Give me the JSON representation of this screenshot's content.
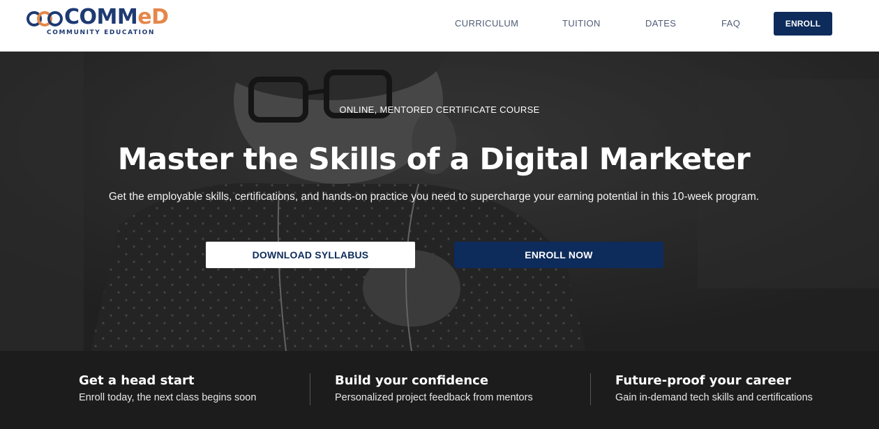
{
  "brand": {
    "name_part1": "COMM",
    "name_part2": "eD",
    "tagline": "COMMUNITY EDUCATION",
    "primary_color": "#1e3a73",
    "accent_color": "#e5874a"
  },
  "nav": {
    "links": [
      {
        "label": "CURRICULUM"
      },
      {
        "label": "TUITION"
      },
      {
        "label": "DATES"
      },
      {
        "label": "FAQ"
      }
    ],
    "cta_label": "ENROLL"
  },
  "hero": {
    "eyebrow": "ONLINE, MENTORED CERTIFICATE COURSE",
    "title": "Master the Skills of a Digital Marketer",
    "subtitle": "Get the employable skills, certifications, and hands-on practice you need to supercharge your earning potential in this 10-week program.",
    "secondary_button": "DOWNLOAD SYLLABUS",
    "primary_button": "ENROLL NOW",
    "button_color": "#0d2b5b"
  },
  "features": [
    {
      "title": "Get a head start",
      "description": "Enroll today, the next class begins soon"
    },
    {
      "title": "Build your confidence",
      "description": "Personalized project feedback from mentors"
    },
    {
      "title": "Future-proof your career",
      "description": "Gain in-demand tech skills and certifications"
    }
  ]
}
